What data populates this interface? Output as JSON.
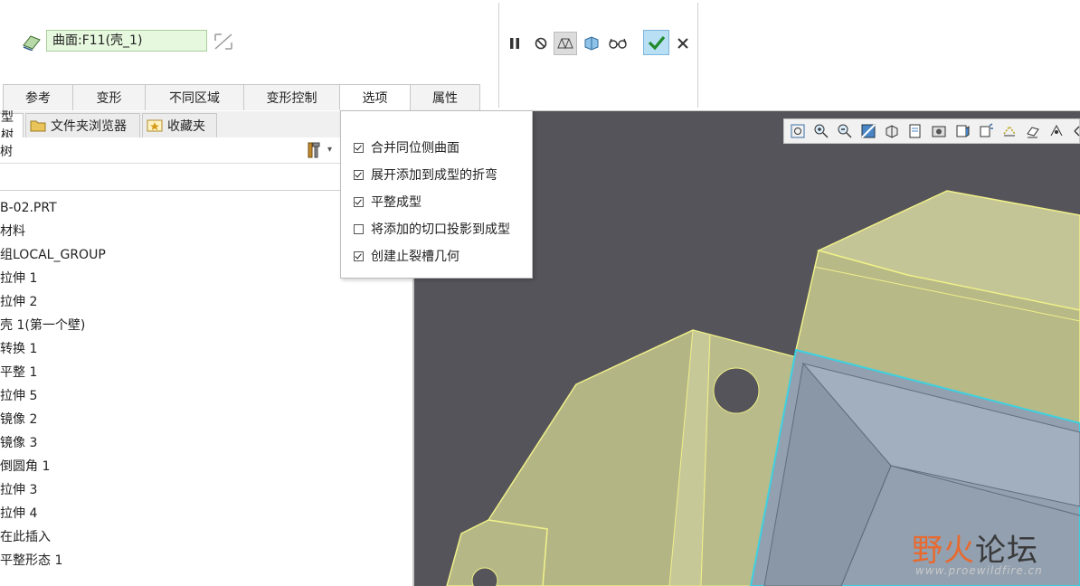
{
  "dashboard": {
    "surface_field": "曲面:F11(壳_1)",
    "tabs": [
      "参考",
      "变形",
      "不同区域",
      "变形控制",
      "选项",
      "属性"
    ],
    "active_tab": "选项"
  },
  "options": [
    {
      "label": "合并同位侧曲面",
      "checked": true
    },
    {
      "label": "展开添加到成型的折弯",
      "checked": true
    },
    {
      "label": "平整成型",
      "checked": true
    },
    {
      "label": "将添加的切口投影到成型",
      "checked": false
    },
    {
      "label": "创建止裂槽几何",
      "checked": true
    }
  ],
  "panel": {
    "tabs": [
      "型树",
      "文件夹浏览器",
      "收藏夹"
    ],
    "tree_title": "树"
  },
  "tree": [
    "B-02.PRT",
    "材料",
    "组LOCAL_GROUP",
    "拉伸 1",
    "拉伸 2",
    "壳 1(第一个壁)",
    "转换 1",
    "平整 1",
    "拉伸 5",
    "镜像 2",
    "镜像 3",
    "倒圆角 1",
    "拉伸 3",
    "拉伸 4",
    "在此插入",
    "平整形态 1"
  ],
  "watermark": {
    "part1": "野火",
    "part2": "论坛",
    "url": "www.proewildfire.cn"
  },
  "colors": {
    "field_bg": "#e6f8de",
    "viewport_bg": "#55545a",
    "model_face": "#b9bb8a",
    "model_inner": "#8e9aaa",
    "ok_button": "#b8dff4"
  }
}
